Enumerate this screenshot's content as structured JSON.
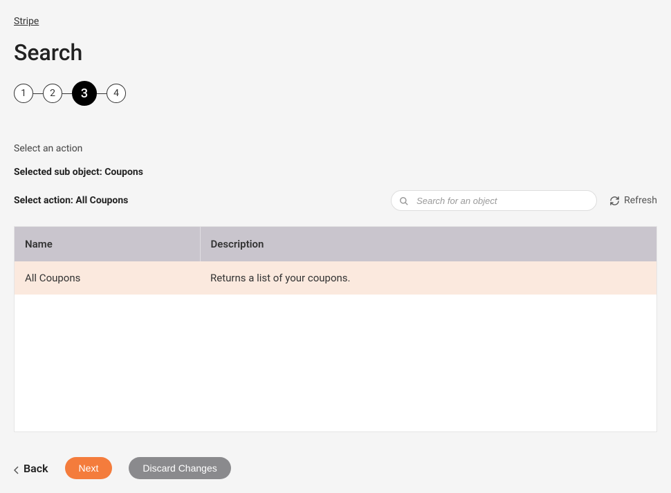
{
  "breadcrumb": "Stripe",
  "page_title": "Search",
  "stepper": {
    "steps": [
      {
        "label": "1",
        "active": false
      },
      {
        "label": "2",
        "active": false
      },
      {
        "label": "3",
        "active": true
      },
      {
        "label": "4",
        "active": false
      }
    ]
  },
  "section_label": "Select an action",
  "sub_object_prefix": "Selected sub object: ",
  "sub_object_value": "Coupons",
  "select_action_prefix": "Select action: ",
  "select_action_value": "All Coupons",
  "search": {
    "placeholder": "Search for an object"
  },
  "refresh_label": "Refresh",
  "table": {
    "headers": {
      "name": "Name",
      "description": "Description"
    },
    "rows": [
      {
        "name": "All Coupons",
        "description": "Returns a list of your coupons."
      }
    ]
  },
  "footer": {
    "back": "Back",
    "next": "Next",
    "discard": "Discard Changes"
  }
}
